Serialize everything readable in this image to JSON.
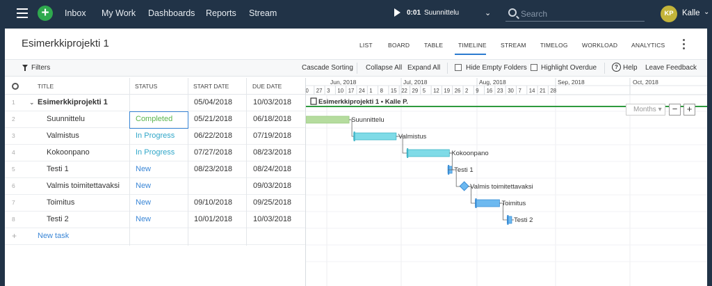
{
  "topbar": {
    "nav": [
      "Inbox",
      "My Work",
      "Dashboards",
      "Reports",
      "Stream"
    ],
    "timer": {
      "time": "0:01",
      "task": "Suunnittelu"
    },
    "search_placeholder": "Search",
    "user_initials": "KP",
    "user_name": "Kalle",
    "colors": {
      "bar": "#213347",
      "add": "#2fa94e",
      "avatar": "#c3b43a"
    }
  },
  "project": {
    "title": "Esimerkkiprojekti 1"
  },
  "view_tabs": [
    "LIST",
    "BOARD",
    "TABLE",
    "TIMELINE",
    "STREAM",
    "TIMELOG",
    "WORKLOAD",
    "ANALYTICS"
  ],
  "active_tab": "TIMELINE",
  "toolbar": {
    "filters": "Filters",
    "cascade": "Cascade Sorting",
    "collapse": "Collapse All",
    "expand": "Expand All",
    "hide_empty": "Hide Empty Folders",
    "highlight_overdue": "Highlight Overdue",
    "help": "Help",
    "feedback": "Leave Feedback"
  },
  "table": {
    "columns": [
      "TITLE",
      "STATUS",
      "START DATE",
      "DUE DATE"
    ],
    "rows": [
      {
        "num": "1",
        "title": "Esimerkkiprojekti 1",
        "status": "",
        "status_type": "",
        "start": "05/04/2018",
        "due": "10/03/2018",
        "is_project": true
      },
      {
        "num": "2",
        "title": "Suunnittelu",
        "status": "Completed",
        "status_type": "completed",
        "start": "05/21/2018",
        "due": "06/18/2018"
      },
      {
        "num": "3",
        "title": "Valmistus",
        "status": "In Progress",
        "status_type": "inprogress",
        "start": "06/22/2018",
        "due": "07/19/2018"
      },
      {
        "num": "4",
        "title": "Kokoonpano",
        "status": "In Progress",
        "status_type": "inprogress",
        "start": "07/27/2018",
        "due": "08/23/2018"
      },
      {
        "num": "5",
        "title": "Testi 1",
        "status": "New",
        "status_type": "new",
        "start": "08/23/2018",
        "due": "08/24/2018"
      },
      {
        "num": "6",
        "title": "Valmis toimitettavaksi",
        "status": "New",
        "status_type": "new",
        "start": "",
        "due": "09/03/2018"
      },
      {
        "num": "7",
        "title": "Toimitus",
        "status": "New",
        "status_type": "new",
        "start": "09/10/2018",
        "due": "09/25/2018"
      },
      {
        "num": "8",
        "title": "Testi 2",
        "status": "New",
        "status_type": "new",
        "start": "10/01/2018",
        "due": "10/03/2018"
      }
    ],
    "new_task": "New task",
    "new_task_symbol": "+"
  },
  "gantt": {
    "months": [
      "Jun, 2018",
      "Jul, 2018",
      "Aug, 2018",
      "Sep, 2018",
      "Oct, 2018"
    ],
    "days": [
      "0",
      "27",
      "3",
      "10",
      "17",
      "24",
      "1",
      "8",
      "15",
      "22",
      "29",
      "5",
      "12",
      "19",
      "26",
      "2",
      "9",
      "16",
      "23",
      "30",
      "7",
      "14",
      "21",
      "28"
    ],
    "project_bar_label": "Esimerkkiprojekti 1 • Kalle P.",
    "scale_label": "Months",
    "zoom_out": "−",
    "zoom_in": "+",
    "bar_labels": [
      "Suunnittelu",
      "Valmistus",
      "Kokoonpano",
      "Testi 1",
      "Valmis toimitettavaksi",
      "Toimitus",
      "Testi 2"
    ],
    "colors": {
      "completed": "#b5dc9e",
      "inprogress": "#7fdbe7",
      "new": "#6db9f0",
      "project": "#2e9a3e"
    }
  }
}
